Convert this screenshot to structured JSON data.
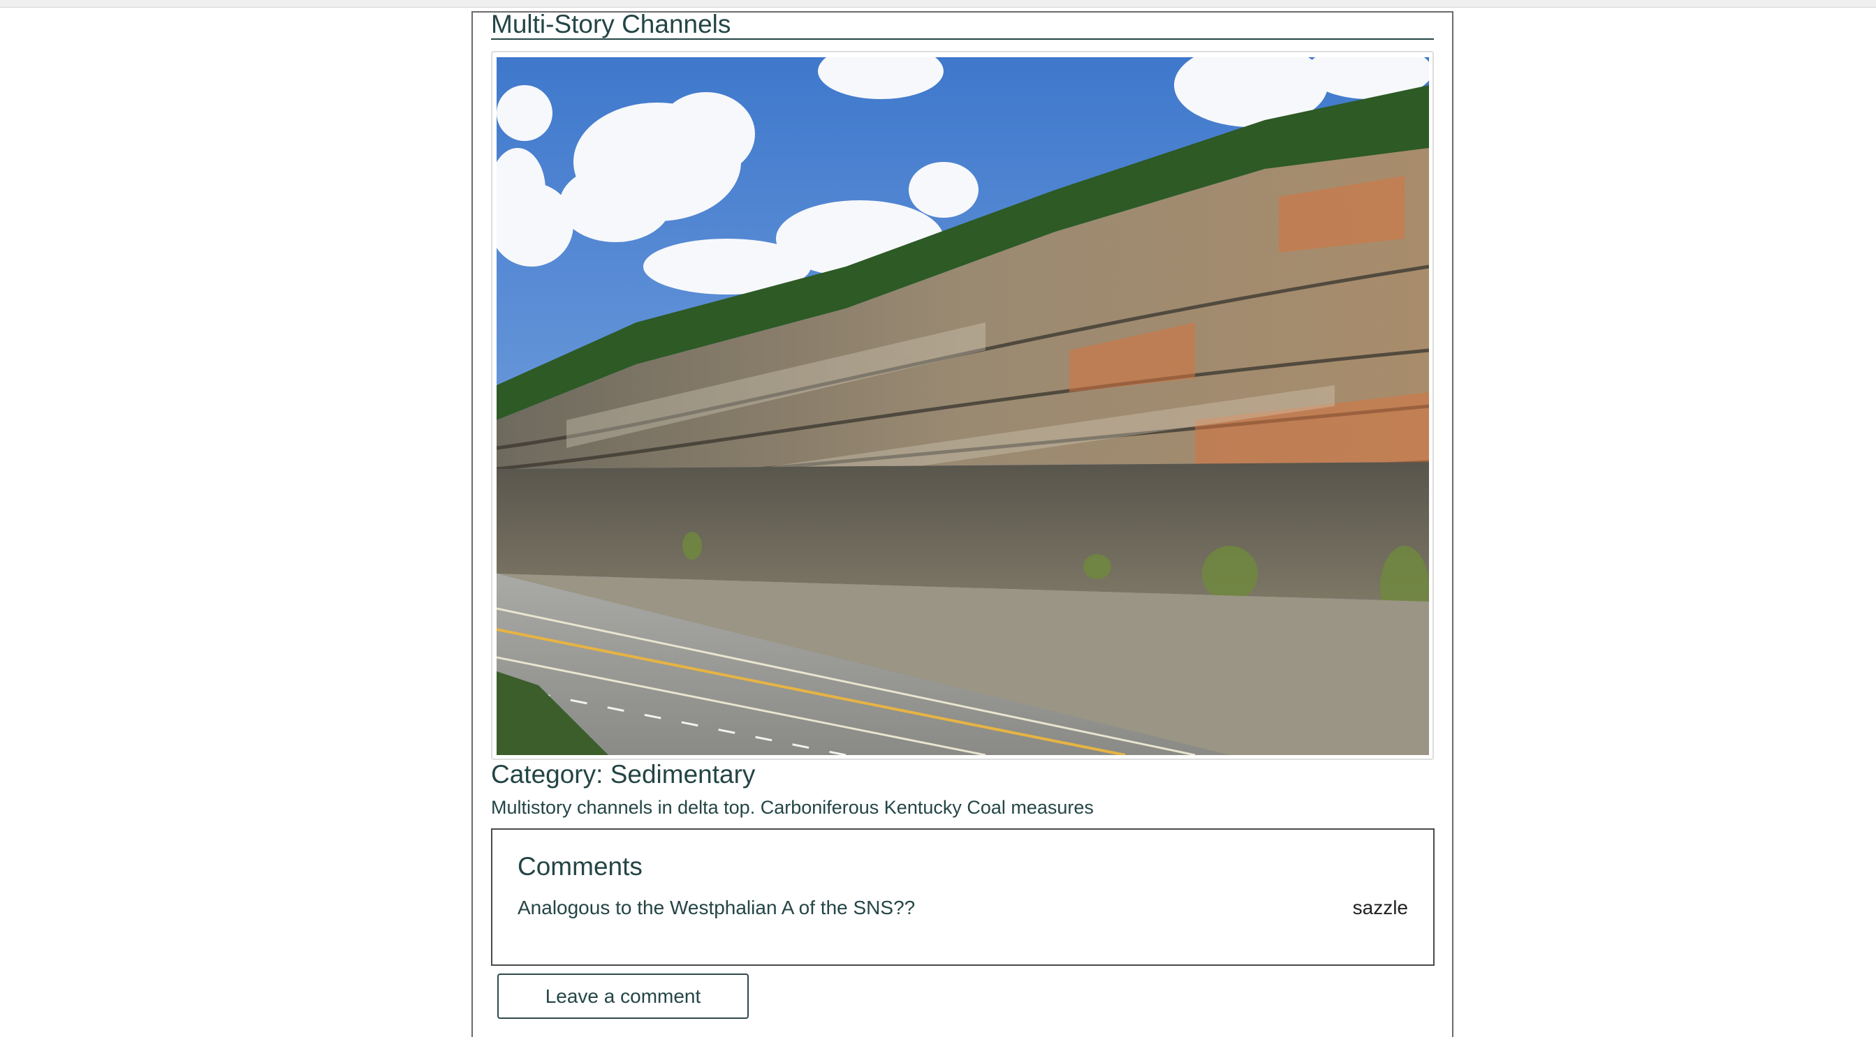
{
  "post": {
    "title": "Multi-Story Channels",
    "image_description_name": "roadcut-photo",
    "category": "Category: Sedimentary",
    "description": "Multistory channels in delta top. Carboniferous Kentucky Coal measures"
  },
  "comments": {
    "heading": "Comments",
    "items": [
      {
        "text": "Analogous to the Westphalian A of the SNS??",
        "author": "sazzle"
      }
    ]
  },
  "actions": {
    "leave_comment_label": "Leave a comment"
  },
  "colors": {
    "text": "#244545",
    "sky": "#5b8fd6",
    "rock_orange": "#c97a4e",
    "road": "#8c8c8c"
  }
}
